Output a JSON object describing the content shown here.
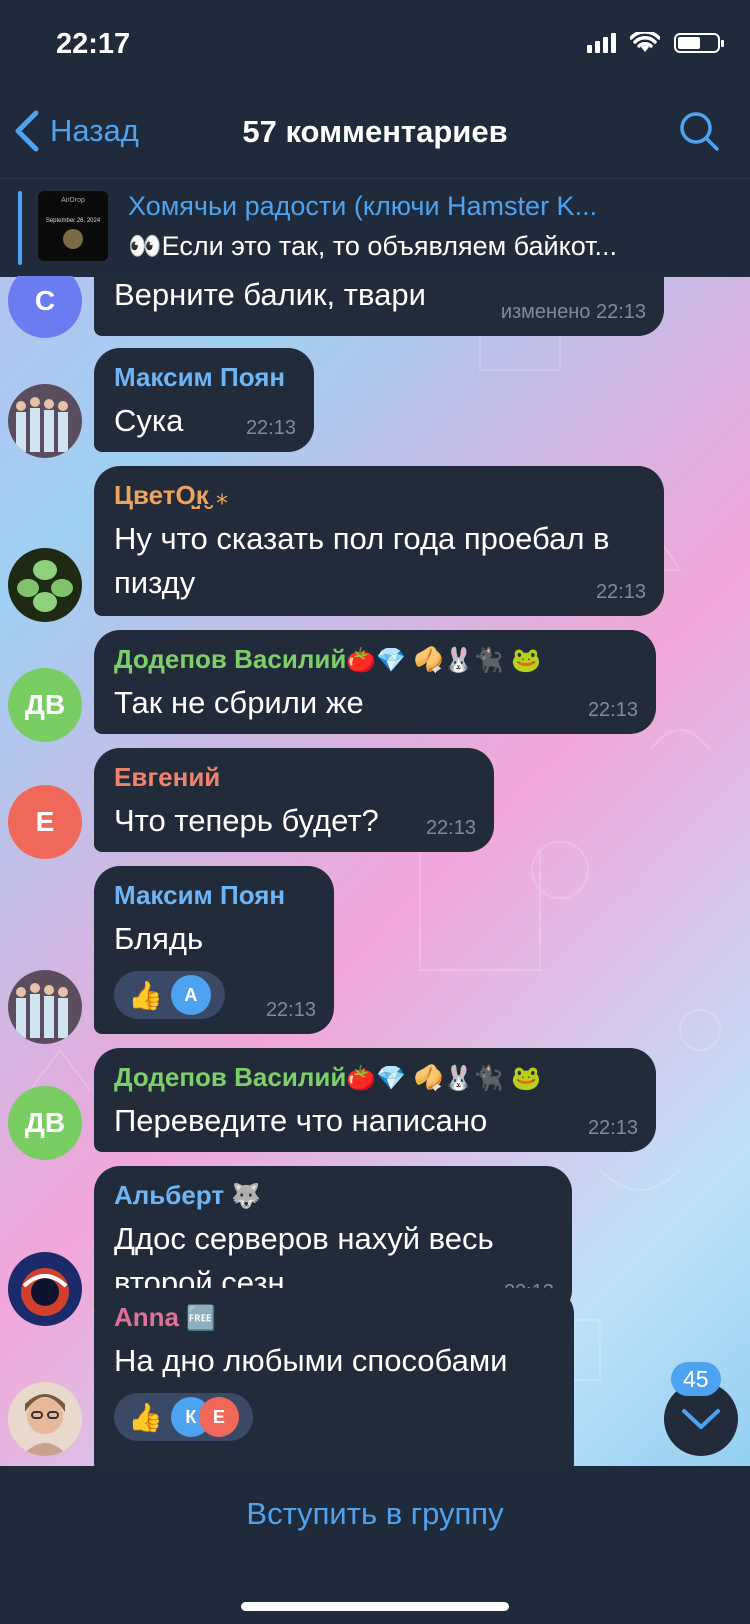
{
  "status_bar": {
    "time": "22:17"
  },
  "header": {
    "back_label": "Назад",
    "title": "57 комментариев",
    "back_icon": "chevron-left-icon",
    "search_icon": "search-icon"
  },
  "pinned": {
    "title": "Хомячьи радости (ключи Hamster K...",
    "text": "👀Если это так, то объявляем байкот...",
    "thumb_line1": "AirDrop",
    "thumb_line2": "September 26, 2024"
  },
  "messages": [
    {
      "sender": "",
      "sender_color": "",
      "text": "Верните балик, твари",
      "time": "изменено 22:13",
      "avatar_initials": "С",
      "avatar_color": "#6a7cf0"
    },
    {
      "sender": "Максим Поян",
      "sender_color": "#6fb5f5",
      "text": "Сука",
      "time": "22:13",
      "avatar_initials": "",
      "avatar_color": "#4a5a70"
    },
    {
      "sender": "ЦветО̤̮к̮",
      "sender_emoji": "⁎",
      "sender_color": "#f0a35a",
      "text": "Ну что сказать пол года проебал в пизду",
      "time": "22:13",
      "avatar_initials": "",
      "avatar_color": "#3d5a2a"
    },
    {
      "sender": "Додепов Василий",
      "sender_emoji": "🍅💎 🥠🐰🐈‍⬛ 🐸",
      "sender_color": "#7dcf6a",
      "text": "Так не сбрили же",
      "time": "22:13",
      "avatar_initials": "ДВ",
      "avatar_color": "#79cd62"
    },
    {
      "sender": "Евгений",
      "sender_color": "#f2836b",
      "text": "Что теперь будет?",
      "time": "22:13",
      "avatar_initials": "Е",
      "avatar_color": "#f0685a"
    },
    {
      "sender": "Максим Поян",
      "sender_color": "#6fb5f5",
      "text": "Блядь",
      "time": "22:13",
      "avatar_initials": "",
      "avatar_color": "#4a5a70",
      "reaction": {
        "emoji": "👍",
        "initials": "А",
        "color": "#4ea3f1"
      }
    },
    {
      "sender": "Додепов Василий",
      "sender_emoji": "🍅💎 🥠🐰🐈‍⬛ 🐸",
      "sender_color": "#7dcf6a",
      "text": "Переведите что написано",
      "time": "22:13",
      "avatar_initials": "ДВ",
      "avatar_color": "#79cd62"
    },
    {
      "sender": "Альберт",
      "sender_emoji": "🐺",
      "sender_color": "#6fb5f5",
      "text": "Ддос серверов нахуй весь второй сезн",
      "time": "22:13",
      "avatar_initials": "",
      "avatar_color": "#2b3b78"
    },
    {
      "sender": "Anna",
      "sender_emoji": "🆓",
      "sender_color": "#e0719a",
      "text": "На дно любыми способами",
      "time": "",
      "avatar_initials": "",
      "avatar_color": "#d8b6a2",
      "reaction": {
        "emoji": "👍",
        "initials": "К",
        "color": "#4ea3f1",
        "initials2": "Е",
        "color2": "#f0685a"
      }
    }
  ],
  "scroll": {
    "unread_count": "45"
  },
  "bottom": {
    "join_label": "Вступить в группу"
  }
}
